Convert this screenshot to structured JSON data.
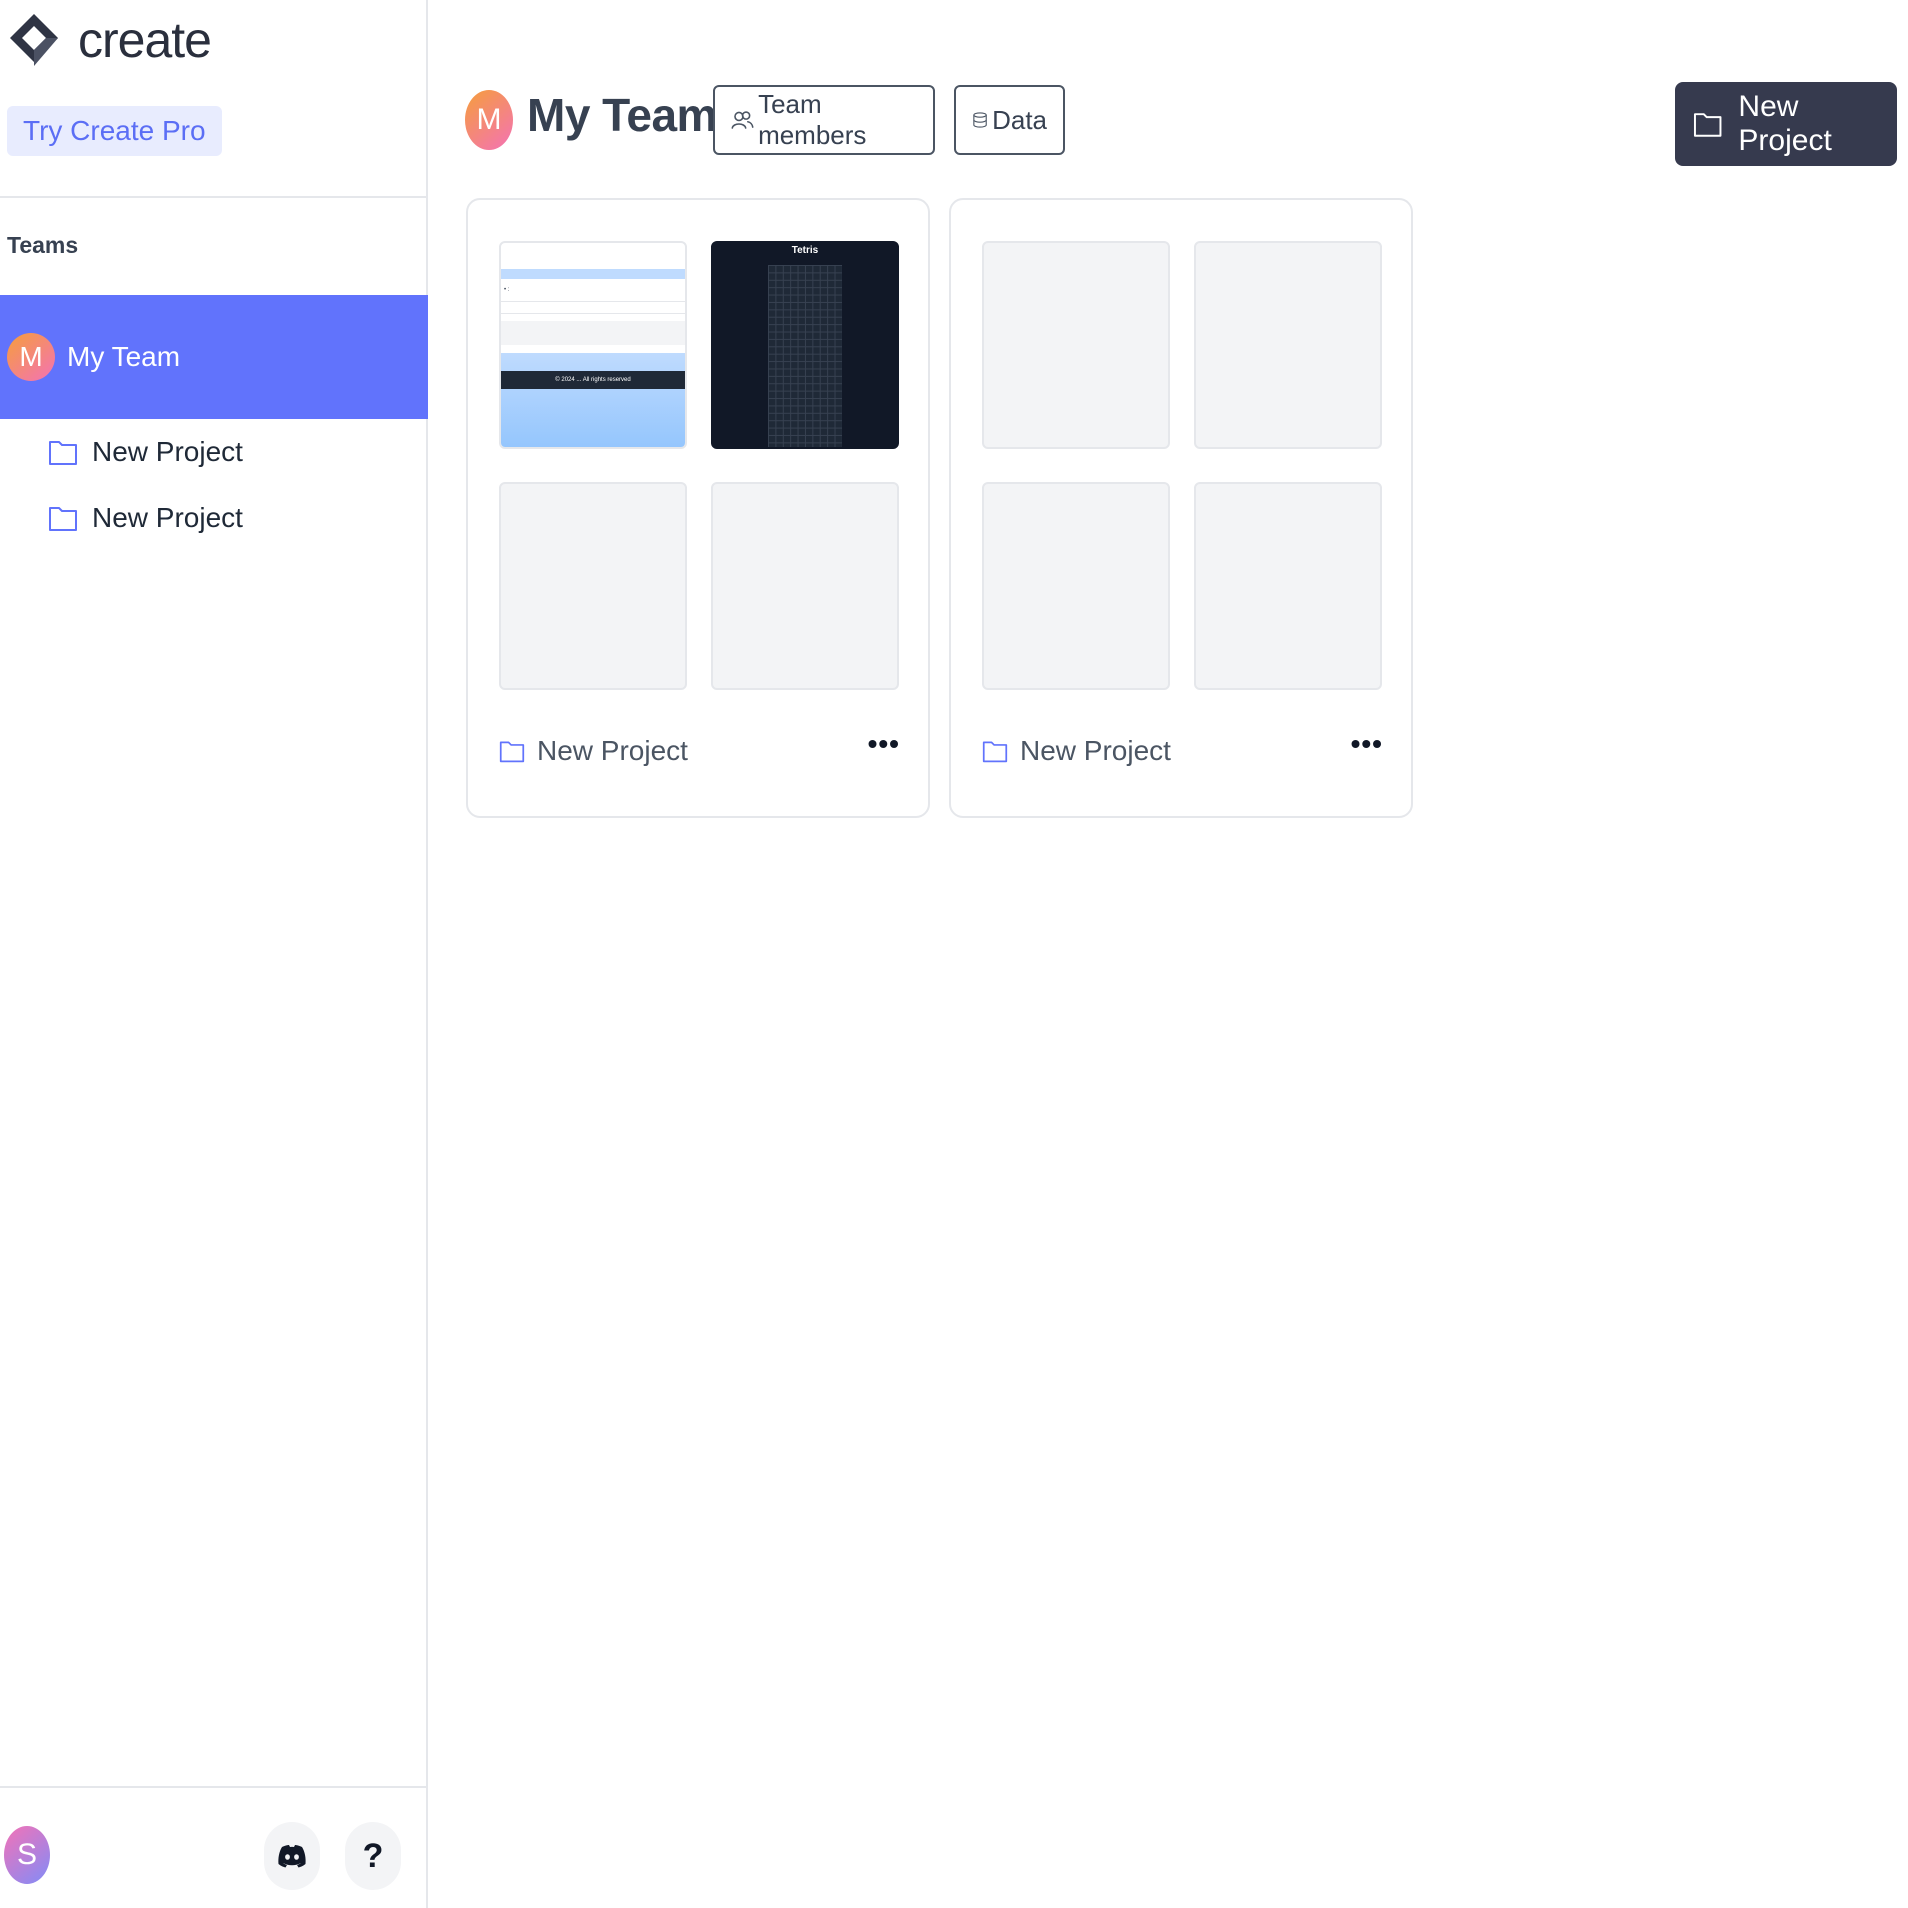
{
  "brand": {
    "name": "create"
  },
  "sidebar": {
    "try_pro": "Try Create Pro",
    "teams_heading": "Teams",
    "team": {
      "initial": "M",
      "label": "My Team"
    },
    "projects": [
      {
        "label": "New Project"
      },
      {
        "label": "New Project"
      }
    ],
    "user_initial": "S",
    "help_label": "?"
  },
  "header": {
    "avatar_initial": "M",
    "title": "My Team",
    "team_members_label": "Team members",
    "data_label": "Data",
    "new_project_label": "New Project"
  },
  "cards": [
    {
      "label": "New Project",
      "menu": "•••",
      "previews": {
        "tetris_title": "Tetris",
        "web_footer": "© 2024 ... All rights reserved",
        "web_text": "• :"
      }
    },
    {
      "label": "New Project",
      "menu": "•••"
    }
  ],
  "colors": {
    "accent": "#6173fc",
    "dark_button": "#363a4e",
    "pro_badge_bg": "#e8ecfe"
  },
  "icons": [
    "logo-icon",
    "folder-icon",
    "users-icon",
    "database-icon",
    "discord-icon",
    "more-icon"
  ]
}
